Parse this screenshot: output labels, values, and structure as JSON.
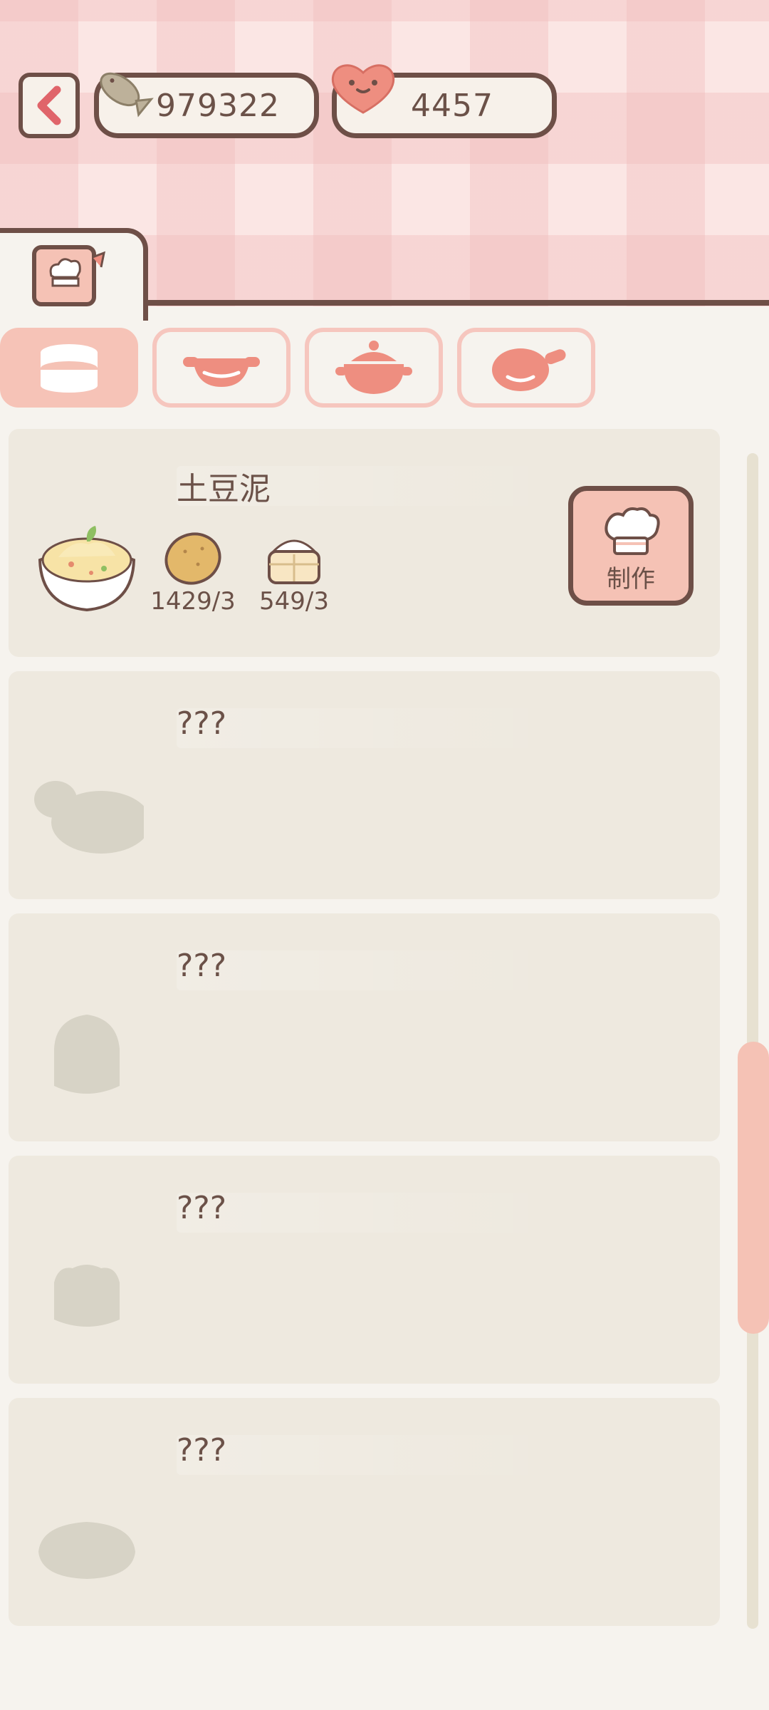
{
  "header": {
    "back_icon": "chevron-left-icon",
    "fish_currency": {
      "icon": "fish-icon",
      "value": "979322"
    },
    "heart_currency": {
      "icon": "heart-face-icon",
      "value": "4457"
    }
  },
  "tabs": [
    {
      "icon": "recipe-book-icon",
      "active": true
    }
  ],
  "categories": [
    {
      "icon": "plate-stack-icon",
      "active": true
    },
    {
      "icon": "wok-icon",
      "active": false
    },
    {
      "icon": "clay-pot-icon",
      "active": false
    },
    {
      "icon": "frying-pan-icon",
      "active": false
    }
  ],
  "recipes": [
    {
      "name": "土豆泥",
      "unlocked": true,
      "dish_icon": "mashed-potato-bowl-icon",
      "ingredients": [
        {
          "icon": "potato-icon",
          "count": "1429/3"
        },
        {
          "icon": "rice-basket-icon",
          "count": "549/3"
        }
      ],
      "make_label": "制作",
      "make_icon": "chef-hat-icon"
    },
    {
      "name": "???",
      "unlocked": false,
      "dish_icon": "locked-dish-silhouette-icon"
    },
    {
      "name": "???",
      "unlocked": false,
      "dish_icon": "locked-dish-silhouette-icon"
    },
    {
      "name": "???",
      "unlocked": false,
      "dish_icon": "locked-dish-silhouette-icon"
    },
    {
      "name": "???",
      "unlocked": false,
      "dish_icon": "locked-dish-silhouette-icon"
    }
  ],
  "colors": {
    "accent": "#f5c2b5",
    "outline": "#6e4f47",
    "card": "#eee9df",
    "background": "#f6f3ee",
    "header_pink": "#fbe6e4"
  }
}
